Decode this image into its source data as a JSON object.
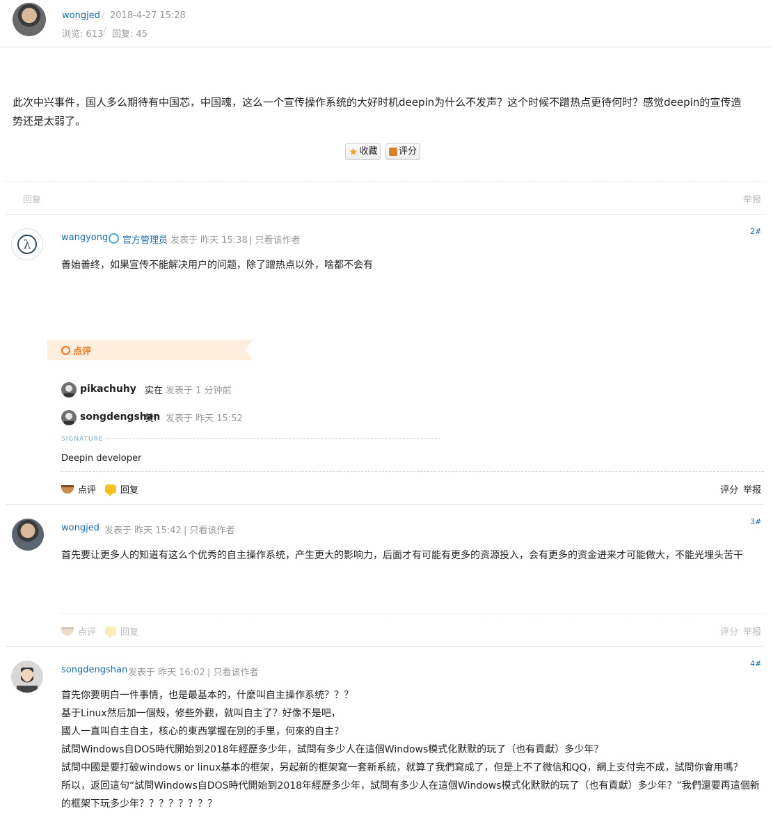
{
  "thread": {
    "author": "wongjed",
    "sep": "/",
    "date": "2018-4-27 15:28",
    "views": "浏览: 613",
    "replies": "回复: 45",
    "content": "此次中兴事件，国人多么期待有中国芯，中国魂，这么一个宣传操作系统的大好时机deepin为什么不发声？这个时候不蹭热点更待何时？感觉deepin的宣传造势还是太弱了。",
    "fav_label": "收藏",
    "rate_label": "评分",
    "reply_label": "回复",
    "report_label": "举报"
  },
  "posts": [
    {
      "floor": "2#",
      "author": "wangyong",
      "role": "官方管理员",
      "time": "发表于 昨天 15:38",
      "only_author": "| 只看该作者",
      "body": "善始善终，如果宣传不能解决用户的问题，除了蹭热点以外，啥都不会有",
      "comment_header": "点评",
      "comments": [
        {
          "user": "pikachuhy",
          "text": "实在",
          "time": "发表于 1 分钟前"
        },
        {
          "user": "songdengshan",
          "text": "赞!",
          "time": "发表于 昨天 15:52"
        }
      ],
      "signature_label": "SIGNATURE",
      "signature": "Deepin developer",
      "actions": {
        "comment": "点评",
        "reply": "回复",
        "rate": "评分",
        "report": "举报"
      }
    },
    {
      "floor": "3#",
      "author": "wongjed",
      "time": "发表于 昨天 15:42",
      "only_author": "| 只看该作者",
      "body": "首先要让更多人的知道有这么个优秀的自主操作系统，产生更大的影响力，后面才有可能有更多的资源投入，会有更多的资金进来才可能做大，不能光埋头苦干",
      "actions": {
        "comment": "点评",
        "reply": "回复",
        "rate": "评分",
        "report": "举报"
      }
    },
    {
      "floor": "4#",
      "author": "songdengshan",
      "time": "发表于 昨天 16:02",
      "only_author": "| 只看该作者",
      "lines": [
        "首先你要明白一件事情，也是最基本的，什麼叫自主操作系统？？？",
        "基于Linux然后加一個殼，修些外觀，就叫自主了？好像不是吧，",
        "國人一直叫自主自主，核心的東西掌握在別的手里，何來的自主？",
        "試問Windows自DOS時代開始到2018年經歷多少年，試問有多少人在這個Windows模式化默默的玩了（也有貢獻）多少年？",
        "試問中國是要打破windows or linux基本的框架，另起新的框架寫一套新系統，就算了我們寫成了，但是上不了微信和QQ，網上支付完不成，試問你會用嗎？",
        "所以，返回這句“試問Windows自DOS時代開始到2018年經歷多少年，試問有多少人在這個Windows模式化默默的玩了（也有貢獻）多少年？”我們還要再這個新",
        "的框架下玩多少年？？？？？？？？"
      ]
    }
  ],
  "colors": {
    "link": "#1a6aa8",
    "accent_orange": "#e8711a",
    "banner": "#fdeede"
  }
}
